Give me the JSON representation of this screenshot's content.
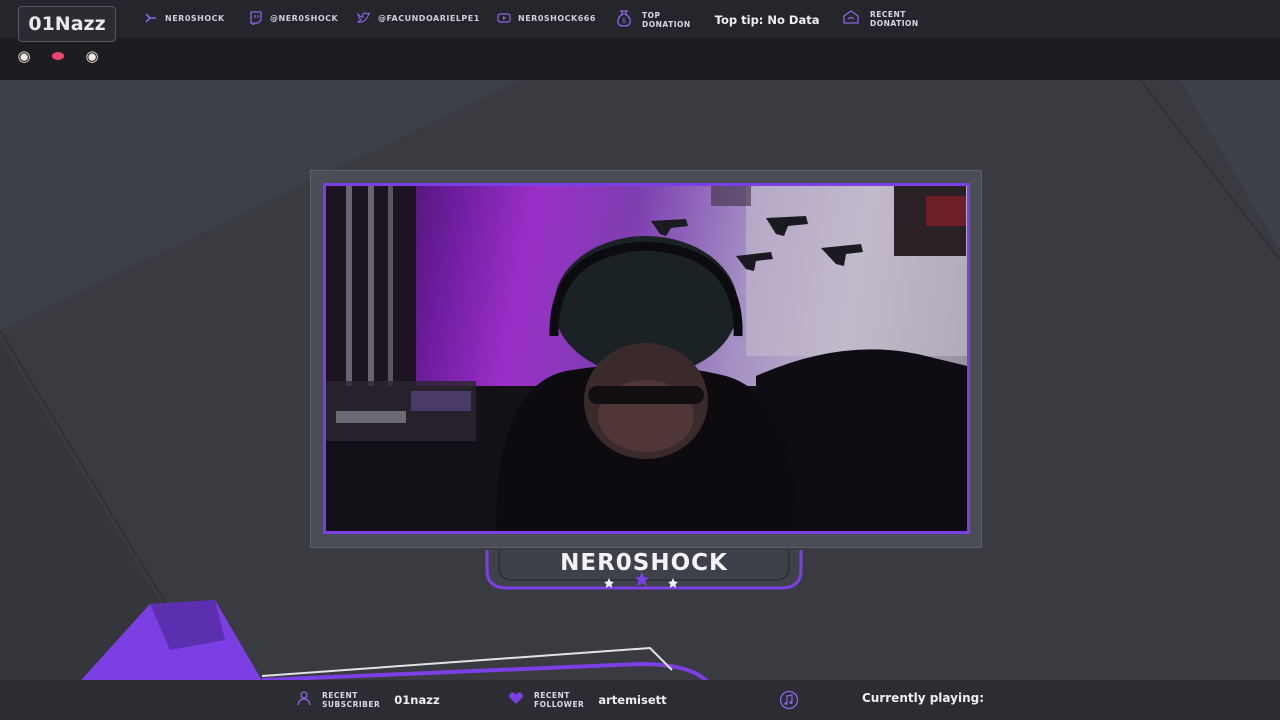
{
  "chat": {
    "username": "01Nazz",
    "emotes": [
      {
        "icon": "eye-emote-icon",
        "glyph": "◉"
      },
      {
        "icon": "lips-emote-icon",
        "glyph": "⬬"
      },
      {
        "icon": "eye-emote-icon",
        "glyph": "◉"
      }
    ]
  },
  "socials": [
    {
      "icon": "kick-icon",
      "label": "NER0SHOCK"
    },
    {
      "icon": "twitch-icon",
      "label": "@NER0SHOCK"
    },
    {
      "icon": "twitter-icon",
      "label": "@FACUNDOARIELPE1"
    },
    {
      "icon": "youtube-icon",
      "label": "NER0SHOCK666"
    }
  ],
  "top_donation": {
    "label_line1": "TOP",
    "label_line2": "DONATION",
    "value": "Top tip: No Data"
  },
  "recent_donation": {
    "label_line1": "RECENT",
    "label_line2": "DONATION"
  },
  "streamer_name": "NER0SHOCK",
  "bottom": {
    "subscriber": {
      "label_line1": "RECENT",
      "label_line2": "SUBSCRIBER",
      "value": "01nazz"
    },
    "follower": {
      "label_line1": "RECENT",
      "label_line2": "FOLLOWER",
      "value": "artemisett"
    },
    "now_playing": "Currently playing:"
  },
  "colors": {
    "accent": "#7b3fe4",
    "background": "#3a3c42",
    "bar": "#1c1d21",
    "text": "#eef0f4"
  }
}
